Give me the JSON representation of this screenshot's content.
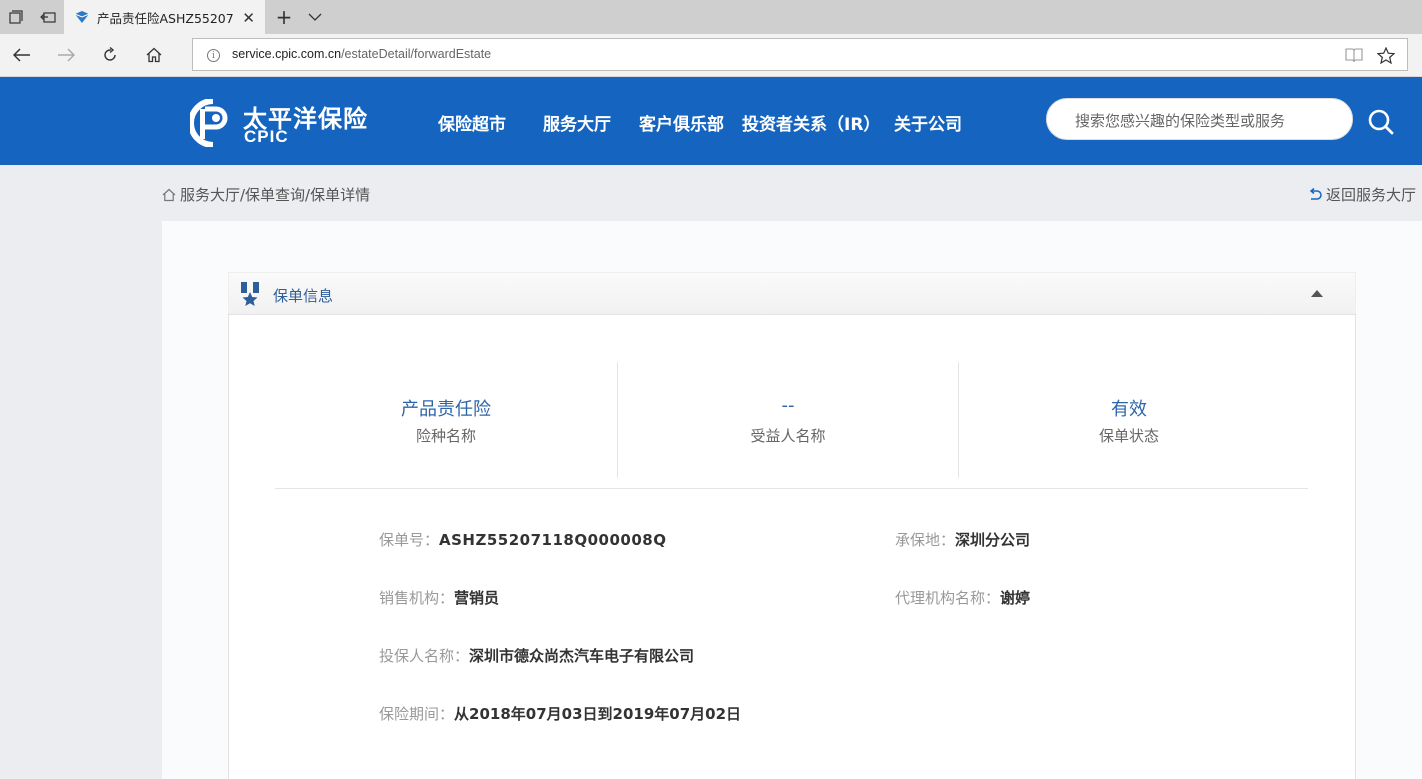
{
  "browser": {
    "tab_title": "产品责任险ASHZ55207",
    "url_host": "service.cpic.com.cn",
    "url_path": "/estateDetail/forwardEstate"
  },
  "site": {
    "logo_cn": "太平洋保险",
    "logo_en": "CPIC",
    "menu": [
      "保险超市",
      "服务大厅",
      "客户俱乐部",
      "投资者关系（IR）",
      "关于公司"
    ],
    "search_placeholder": "搜索您感兴趣的保险类型或服务"
  },
  "breadcrumb": {
    "text": "服务大厅/保单查询/保单详情",
    "back": "返回服务大厅"
  },
  "panel": {
    "title": "保单信息",
    "stats": [
      {
        "value": "产品责任险",
        "label": "险种名称"
      },
      {
        "value": "--",
        "label": "受益人名称"
      },
      {
        "value": "有效",
        "label": "保单状态"
      }
    ],
    "fields": {
      "policy_no": {
        "label": "保单号：",
        "value": "ASHZ55207118Q000008Q"
      },
      "underwriting_place": {
        "label": "承保地：",
        "value": "深圳分公司"
      },
      "sales_org": {
        "label": "销售机构：",
        "value": "营销员"
      },
      "agent_org": {
        "label": "代理机构名称：",
        "value": "谢婷"
      },
      "insured": {
        "label": "投保人名称：",
        "value": "深圳市德众尚杰汽车电子有限公司"
      },
      "period": {
        "label": "保险期间：",
        "value": "从2018年07月03日到2019年07月02日"
      }
    }
  },
  "colors": {
    "header_blue": "#1565c0",
    "accent_text": "#2d64a8"
  }
}
